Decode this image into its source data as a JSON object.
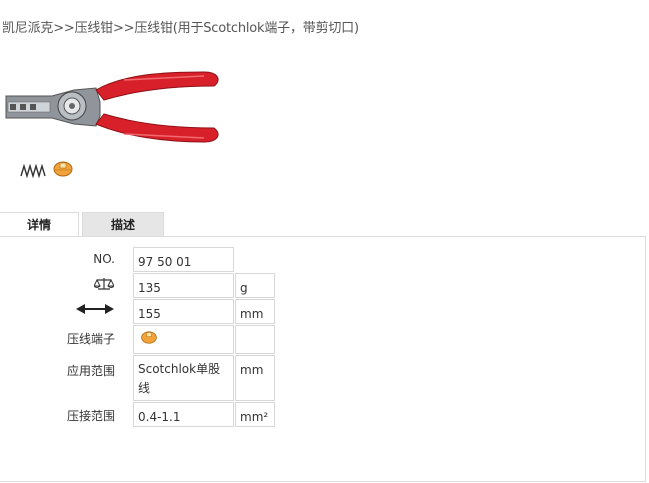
{
  "breadcrumb": "凯尼派克>>压线钳>>压线钳(用于Scotchlok端子，带剪切口)",
  "images": {
    "product": "crimping-pliers",
    "thumb_spring": "spring-icon",
    "thumb_connector": "connector-icon"
  },
  "tabs": {
    "details": "详情",
    "description": "描述"
  },
  "specs": {
    "no_label": "NO.",
    "no_value": "97 50 01",
    "weight_icon": "scale-icon",
    "weight_value": "135",
    "weight_unit": "g",
    "length_icon": "double-arrow-icon",
    "length_value": "155",
    "length_unit": "mm",
    "terminal_label": "压线端子",
    "range_label": "应用范围",
    "range_value": "Scotchlok单股线",
    "range_unit": "mm",
    "crimp_label": "压接范围",
    "crimp_value": "0.4-1.1",
    "crimp_unit": "mm²"
  },
  "colors": {
    "handle_red": "#d8202a",
    "metal": "#9aa0a6",
    "connector_orange": "#f2a33a"
  }
}
